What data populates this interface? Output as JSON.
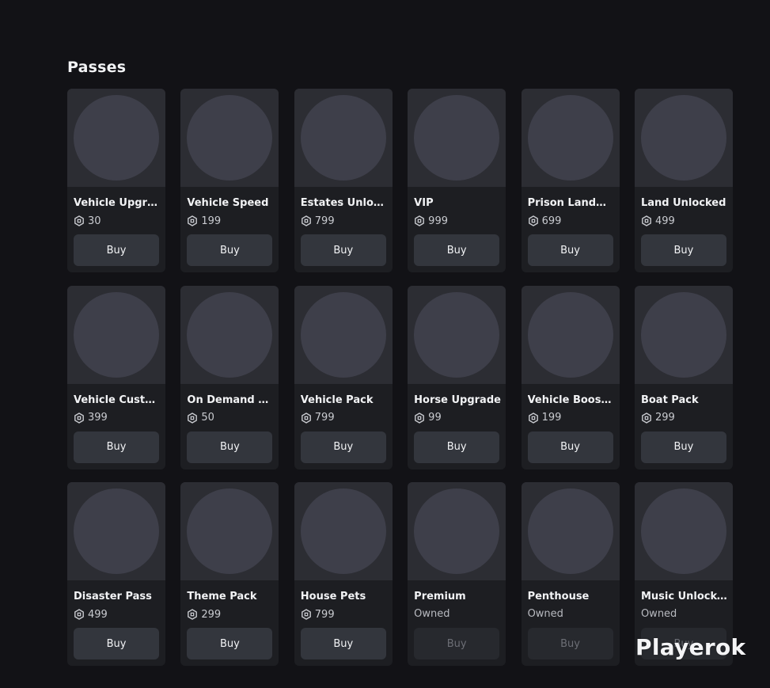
{
  "section": {
    "title": "Passes"
  },
  "currency_icon": "robux-icon",
  "passes": [
    {
      "name": "Vehicle Upgra...",
      "price": "30",
      "owned": false,
      "buy_label": "Buy"
    },
    {
      "name": "Vehicle Speed",
      "price": "199",
      "owned": false,
      "buy_label": "Buy"
    },
    {
      "name": "Estates Unloc...",
      "price": "799",
      "owned": false,
      "buy_label": "Buy"
    },
    {
      "name": "VIP",
      "price": "999",
      "owned": false,
      "buy_label": "Buy"
    },
    {
      "name": "Prison Landm...",
      "price": "699",
      "owned": false,
      "buy_label": "Buy"
    },
    {
      "name": "Land Unlocked",
      "price": "499",
      "owned": false,
      "buy_label": "Buy"
    },
    {
      "name": "Vehicle Custo...",
      "price": "399",
      "owned": false,
      "buy_label": "Buy"
    },
    {
      "name": "On Demand Fi...",
      "price": "50",
      "owned": false,
      "buy_label": "Buy"
    },
    {
      "name": "Vehicle Pack",
      "price": "799",
      "owned": false,
      "buy_label": "Buy"
    },
    {
      "name": "Horse Upgrade",
      "price": "99",
      "owned": false,
      "buy_label": "Buy"
    },
    {
      "name": "Vehicle Boost ...",
      "price": "199",
      "owned": false,
      "buy_label": "Buy"
    },
    {
      "name": "Boat Pack",
      "price": "299",
      "owned": false,
      "buy_label": "Buy"
    },
    {
      "name": "Disaster Pass",
      "price": "499",
      "owned": false,
      "buy_label": "Buy"
    },
    {
      "name": "Theme Pack",
      "price": "299",
      "owned": false,
      "buy_label": "Buy"
    },
    {
      "name": "House Pets",
      "price": "799",
      "owned": false,
      "buy_label": "Buy"
    },
    {
      "name": "Premium",
      "status": "Owned",
      "owned": true,
      "buy_label": "Buy"
    },
    {
      "name": "Penthouse",
      "status": "Owned",
      "owned": true,
      "buy_label": "Buy"
    },
    {
      "name": "Music Unlocked",
      "status": "Owned",
      "owned": true,
      "buy_label": "Buy"
    }
  ],
  "watermark": {
    "text": "Playerok"
  },
  "colors": {
    "background": "#121216",
    "card": "#1d1e22",
    "thumb": "#2c2d33",
    "thumb_circle": "#3e3f4a",
    "button": "#33363d",
    "button_disabled": "#27292e"
  }
}
